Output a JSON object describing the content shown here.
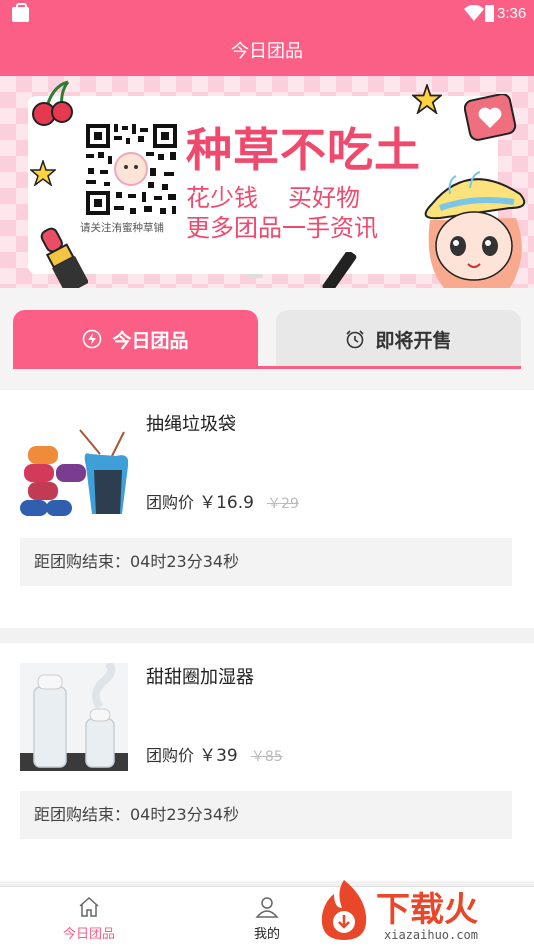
{
  "status_bar": {
    "time": "3:36"
  },
  "header": {
    "title": "今日团品"
  },
  "banner": {
    "headline": "种草不吃土",
    "line2_left": "花少钱",
    "line2_right": "买好物",
    "line3": "更多团品一手资讯",
    "qr_caption": "请关注洧蜜种草铺"
  },
  "tabs": [
    {
      "label": "今日团品",
      "icon": "lightning-icon",
      "active": true
    },
    {
      "label": "即将开售",
      "icon": "alarm-clock-icon",
      "active": false
    }
  ],
  "products": [
    {
      "name": "抽绳垃圾袋",
      "price_label": "团购价",
      "price": "￥16.9",
      "original_price": "￥29",
      "countdown": "距团购结束：04时23分34秒"
    },
    {
      "name": "甜甜圈加湿器",
      "price_label": "团购价",
      "price": "￥39",
      "original_price": "￥85",
      "countdown": "距团购结束：04时23分34秒"
    }
  ],
  "bottom_nav": [
    {
      "label": "今日团品",
      "icon": "home-icon",
      "active": true
    },
    {
      "label": "我的",
      "icon": "user-icon",
      "active": false
    }
  ],
  "watermark": {
    "text": "下载火",
    "url": "xiazaihuo.com"
  },
  "colors": {
    "accent": "#fc5f85",
    "headline": "#ef4a6e"
  }
}
